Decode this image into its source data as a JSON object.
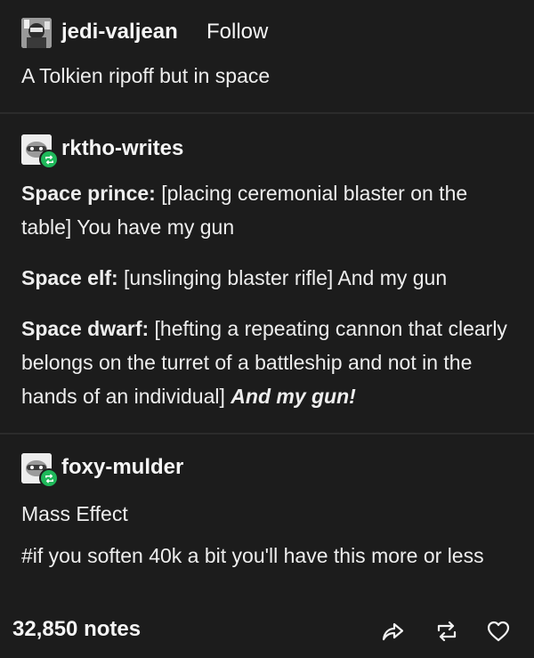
{
  "post1": {
    "username": "jedi-valjean",
    "follow_label": "Follow",
    "text": "A Tolkien ripoff but in space"
  },
  "post2": {
    "username": "rktho-writes",
    "lines": [
      {
        "speaker": "Space prince:",
        "text": " [placing ceremonial blaster on the table] You have my gun"
      },
      {
        "speaker": "Space elf:",
        "text": " [unslinging blaster rifle] And my gun"
      },
      {
        "speaker": "Space dwarf:",
        "text": " [hefting a repeating cannon that clearly belongs on the turret of a battleship and not in the hands of an individual] ",
        "emphasis": "And my gun!"
      }
    ]
  },
  "post3": {
    "username": "foxy-mulder",
    "text": "Mass Effect",
    "tag": "#if you soften 40k a bit you'll have this more or less"
  },
  "footer": {
    "notes": "32,850 notes",
    "icons": [
      "share-icon",
      "reblog-icon",
      "like-icon"
    ]
  },
  "colors": {
    "background": "#1c1c1c",
    "text": "#f2f2f2",
    "reblog_badge": "#1fb85a"
  }
}
